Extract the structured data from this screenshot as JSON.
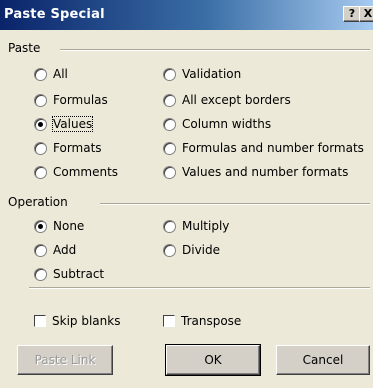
{
  "window": {
    "title": "Paste Special",
    "help_glyph": "?",
    "close_glyph": "X"
  },
  "paste_group": {
    "label": "Paste",
    "left_options": [
      {
        "label": "All",
        "checked": false
      },
      {
        "label": "Formulas",
        "checked": false
      },
      {
        "label": "Values",
        "checked": true
      },
      {
        "label": "Formats",
        "checked": false
      },
      {
        "label": "Comments",
        "checked": false
      }
    ],
    "right_options": [
      {
        "label": "Validation",
        "checked": false
      },
      {
        "label": "All except borders",
        "checked": false
      },
      {
        "label": "Column widths",
        "checked": false
      },
      {
        "label": "Formulas and number formats",
        "checked": false
      },
      {
        "label": "Values and number formats",
        "checked": false
      }
    ]
  },
  "operation_group": {
    "label": "Operation",
    "left_options": [
      {
        "label": "None",
        "checked": true
      },
      {
        "label": "Add",
        "checked": false
      },
      {
        "label": "Subtract",
        "checked": false
      }
    ],
    "right_options": [
      {
        "label": "Multiply",
        "checked": false
      },
      {
        "label": "Divide",
        "checked": false
      }
    ]
  },
  "checkboxes": {
    "skip_blanks": {
      "label": "Skip blanks",
      "checked": false
    },
    "transpose": {
      "label": "Transpose",
      "checked": false
    }
  },
  "buttons": {
    "paste_link": "Paste Link",
    "ok": "OK",
    "cancel": "Cancel"
  },
  "colors": {
    "dialog_bg": "#ece9d8",
    "title_start": "#0a246a",
    "title_end": "#a6caf0"
  }
}
